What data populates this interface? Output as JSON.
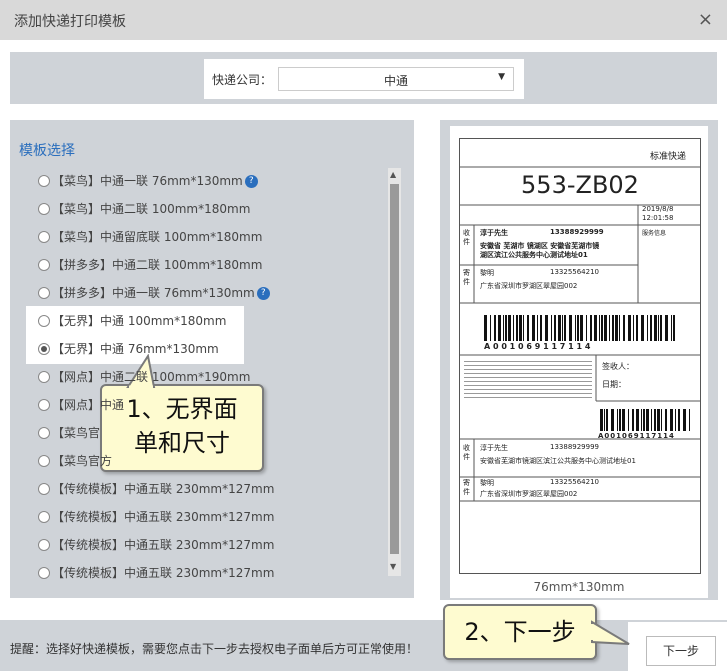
{
  "dialog": {
    "title": "添加快递打印模板",
    "close_symbol": "×"
  },
  "company": {
    "label": "快递公司：",
    "value": "中通"
  },
  "templates": {
    "heading": "模板选择",
    "items": [
      {
        "label": "【菜鸟】中通一联 76mm*130mm",
        "help": true,
        "selected": false
      },
      {
        "label": "【菜鸟】中通二联 100mm*180mm",
        "help": false,
        "selected": false
      },
      {
        "label": "【菜鸟】中通留底联 100mm*180mm",
        "help": false,
        "selected": false
      },
      {
        "label": "【拼多多】中通二联 100mm*180mm",
        "help": false,
        "selected": false
      },
      {
        "label": "【拼多多】中通一联 76mm*130mm",
        "help": true,
        "selected": false
      },
      {
        "label": "【无界】中通 100mm*180mm",
        "help": false,
        "selected": false
      },
      {
        "label": "【无界】中通 76mm*130mm",
        "help": false,
        "selected": true
      },
      {
        "label": "【网点】中通二联 100mm*190mm",
        "help": false,
        "selected": false
      },
      {
        "label": "【网点】中通",
        "help": false,
        "selected": false
      },
      {
        "label": "【菜鸟官",
        "help": false,
        "selected": false
      },
      {
        "label": "【菜鸟官方",
        "help": false,
        "selected": false
      },
      {
        "label": "【传统模板】中通五联 230mm*127mm",
        "help": false,
        "selected": false
      },
      {
        "label": "【传统模板】中通五联 230mm*127mm",
        "help": false,
        "selected": false
      },
      {
        "label": "【传统模板】中通五联 230mm*127mm",
        "help": false,
        "selected": false
      },
      {
        "label": "【传统模板】中通五联 230mm*127mm",
        "help": false,
        "selected": false
      }
    ]
  },
  "preview": {
    "service": "标准快递",
    "code": "553-ZB02",
    "date": "2019/8/8",
    "time": "12:01:58",
    "recv_tag": "收件",
    "recv_name": "淳于先生",
    "recv_phone": "13388929999",
    "recv_addr1": "安徽省 芜湖市 镜湖区  安徽省芜湖市镜",
    "recv_addr2": "湖区滨江公共服务中心测试地址01",
    "service_info": "服务信息",
    "send_tag": "寄件",
    "send_name": "黎明",
    "send_phone": "13325564210",
    "send_addr": "广东省深圳市罗湖区翠屋园002",
    "barcode_text": "A 0 0 1 0 6 9 1 1 7 1 1 4",
    "barcode_text2": "A001069117114",
    "sign_label": "签收人：",
    "date_label": "日期：",
    "recv_addr_full": "安徽省芜湖市镜湖区滨江公共服务中心测试地址01",
    "size_caption": "76mm*130mm"
  },
  "footer": {
    "tip": "提醒：选择好快递模板，需要您点击下一步去授权电子面单后方可正常使用！",
    "next_label": "下一步"
  },
  "callouts": {
    "c1_line1": "1、无界面",
    "c1_line2": "单和尺寸",
    "c2": "2、下一步"
  }
}
